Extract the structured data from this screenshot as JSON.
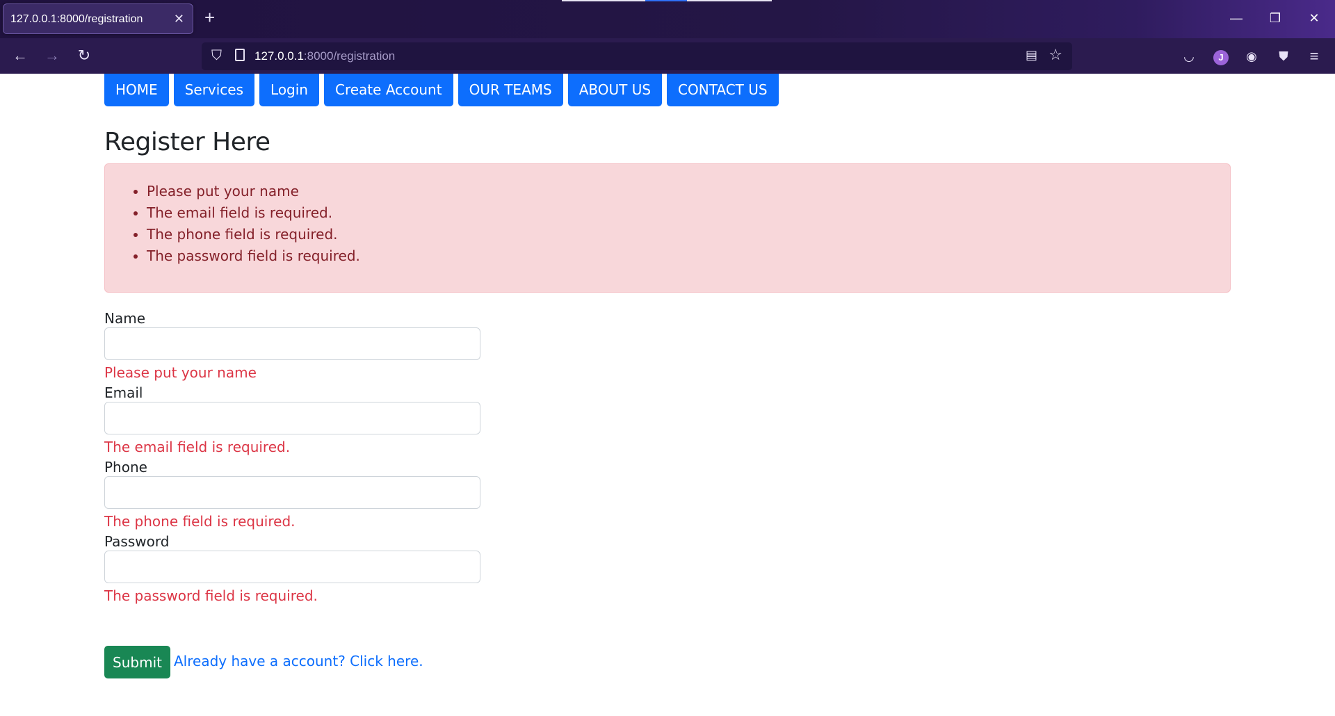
{
  "browser": {
    "tab_title": "127.0.0.1:8000/registration",
    "url_host": "127.0.0.1",
    "url_rest": ":8000/registration",
    "avatar_letter": "J"
  },
  "nav": {
    "items": [
      "HOME",
      "Services",
      "Login",
      "Create Account",
      "OUR TEAMS",
      "ABOUT US",
      "CONTACT US"
    ]
  },
  "page": {
    "title": "Register Here",
    "errors": [
      "Please put your name",
      "The email field is required.",
      "The phone field is required.",
      "The password field is required."
    ],
    "fields": [
      {
        "label": "Name",
        "value": "",
        "error": "Please put your name"
      },
      {
        "label": "Email",
        "value": "",
        "error": "The email field is required."
      },
      {
        "label": "Phone",
        "value": "",
        "error": "The phone field is required."
      },
      {
        "label": "Password",
        "value": "",
        "error": "The password field is required."
      }
    ],
    "submit_label": "Submit",
    "login_link": "Already have a account? Click here."
  },
  "colors": {
    "primary": "#0d6efd",
    "success": "#198754",
    "danger": "#dc3545",
    "alert_bg": "#f8d7da"
  }
}
